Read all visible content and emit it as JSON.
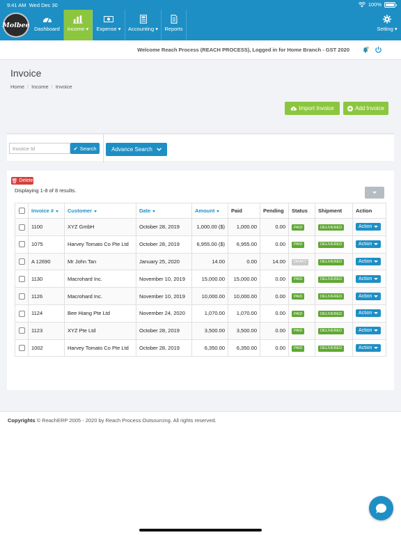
{
  "status_bar": {
    "time": "9:41 AM",
    "date": "Wed Dec 30",
    "battery": "100%"
  },
  "nav": {
    "logo_text": "Molbee",
    "items": [
      {
        "label": "Dashboard",
        "icon": "dashboard-icon"
      },
      {
        "label": "Income",
        "icon": "bar-chart-icon",
        "has_dropdown": true,
        "active": true
      },
      {
        "label": "Expense",
        "icon": "money-icon",
        "has_dropdown": true
      },
      {
        "label": "Accounting",
        "icon": "calculator-icon",
        "has_dropdown": true
      },
      {
        "label": "Reports",
        "icon": "document-icon"
      },
      {
        "label": "Setting",
        "icon": "gear-icon",
        "has_dropdown": true
      }
    ]
  },
  "welcome": {
    "message": "Welcome Reach Process (REACH PROCESS), Logged in for Home Branch - GST 2020"
  },
  "page": {
    "title": "Invoice",
    "breadcrumb": [
      "Home",
      "Income",
      "Invoice"
    ],
    "import_label": "Import Invoice",
    "add_label": "Add Invoice"
  },
  "search": {
    "placeholder": "Invoice Id",
    "search_label": "Search",
    "advance_label": "Advance Search"
  },
  "list": {
    "delete_label": "Delete",
    "displaying": "Displaying 1-8 of 8 results.",
    "columns": [
      "Invoice #",
      "Customer",
      "Date",
      "Amount",
      "Paid",
      "Pending",
      "Status",
      "Shipment",
      "Action"
    ],
    "rows": [
      {
        "invoice": "1100",
        "customer": "XYZ GmbH",
        "date": "October 28, 2019",
        "amount": "1,000.00 ($)",
        "paid": "1,000.00",
        "pending": "0.00",
        "status": "PAID",
        "shipment": "DELIVERED",
        "action": "Action"
      },
      {
        "invoice": "1075",
        "customer": "Harvey Tomato Co Pte Ltd",
        "date": "October 28, 2019",
        "amount": "6,955.00 ($)",
        "paid": "6,955.00",
        "pending": "0.00",
        "status": "PAID",
        "shipment": "DELIVERED",
        "action": "Action"
      },
      {
        "invoice": "A 12690",
        "customer": "Mr John Tan",
        "date": "January 25, 2020",
        "amount": "14.00",
        "paid": "0.00",
        "pending": "14.00",
        "status": "DRAFT",
        "shipment": "DELIVERED",
        "action": "Action"
      },
      {
        "invoice": "1130",
        "customer": "Macrohard Inc.",
        "date": "November 10, 2019",
        "amount": "15,000.00",
        "paid": "15,000.00",
        "pending": "0.00",
        "status": "PAID",
        "shipment": "DELIVERED",
        "action": "Action"
      },
      {
        "invoice": "1126",
        "customer": "Macrohard Inc.",
        "date": "November 10, 2019",
        "amount": "10,000.00",
        "paid": "10,000.00",
        "pending": "0.00",
        "status": "PAID",
        "shipment": "DELIVERED",
        "action": "Action"
      },
      {
        "invoice": "1124",
        "customer": "Bee Hiang Pte Ltd",
        "date": "November 24, 2020",
        "amount": "1,070.00",
        "paid": "1,070.00",
        "pending": "0.00",
        "status": "PAID",
        "shipment": "DELIVERED",
        "action": "Action"
      },
      {
        "invoice": "1123",
        "customer": "XYZ Pte Ltd",
        "date": "October 28, 2019",
        "amount": "3,500.00",
        "paid": "3,500.00",
        "pending": "0.00",
        "status": "PAID",
        "shipment": "DELIVERED",
        "action": "Action"
      },
      {
        "invoice": "1002",
        "customer": "Harvey Tomato Co Pte Ltd",
        "date": "October 28, 2019",
        "amount": "6,350.00",
        "paid": "6,350.00",
        "pending": "0.00",
        "status": "PAID",
        "shipment": "DELIVERED",
        "action": "Action"
      }
    ]
  },
  "footer": {
    "copyright_label": "Copyrights",
    "copyright_text": "© ReachERP 2005 - 2020 by Reach Process Outsourcing. All rights reserved."
  },
  "colors": {
    "primary": "#1e8fc5",
    "accent_green": "#8cc63f",
    "danger": "#d43f3a",
    "badge_green": "#5fa832",
    "badge_draft": "#c9c9c9"
  }
}
